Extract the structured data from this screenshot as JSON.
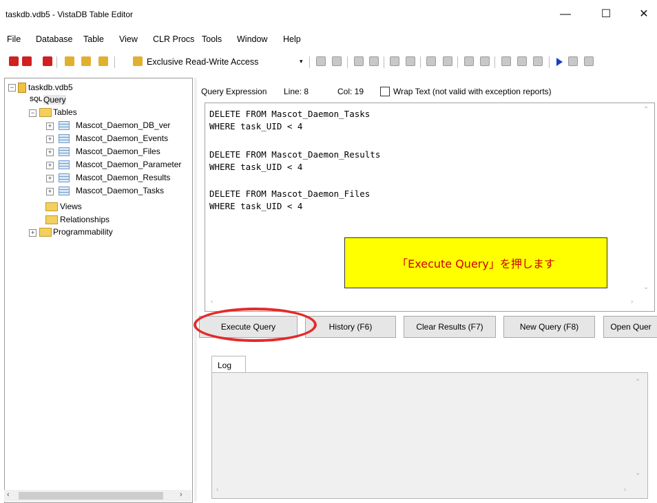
{
  "window": {
    "title": "taskdb.vdb5 - VistaDB Table Editor",
    "minimize": "—",
    "maximize": "☐",
    "close": "✕"
  },
  "menu": [
    "File",
    "Database",
    "Table",
    "View",
    "CLR Procs",
    "Tools",
    "Window",
    "Help"
  ],
  "toolbar": {
    "access_label": "Exclusive Read-Write Access",
    "access_arrow": "▾"
  },
  "tree": {
    "db": "taskdb.vdb5",
    "query": "Query",
    "tables": "Tables",
    "tables_list": [
      "Mascot_Daemon_DB_ver",
      "Mascot_Daemon_Events",
      "Mascot_Daemon_Files",
      "Mascot_Daemon_Parameter",
      "Mascot_Daemon_Results",
      "Mascot_Daemon_Tasks"
    ],
    "views": "Views",
    "relationships": "Relationships",
    "programmability": "Programmability"
  },
  "query": {
    "label": "Query Expression",
    "line": "Line: 8",
    "col": "Col: 19",
    "wrap": "Wrap Text (not valid with exception reports)",
    "code": [
      "DELETE FROM Mascot_Daemon_Tasks",
      "WHERE task_UID < 4",
      "",
      "DELETE FROM Mascot_Daemon_Results",
      "WHERE task_UID < 4",
      "",
      "DELETE FROM Mascot_Daemon_Files",
      "WHERE task_UID < 4"
    ]
  },
  "callout": "「Execute Query」を押します",
  "buttons": {
    "execute": "Execute Query",
    "history": "History (F6)",
    "clear": "Clear Results (F7)",
    "new": "New Query (F8)",
    "open": "Open Quer"
  },
  "log": {
    "tab": "Log"
  },
  "colors": {
    "highlight": "#ffff00",
    "annotation_red": "#e32b2b"
  }
}
